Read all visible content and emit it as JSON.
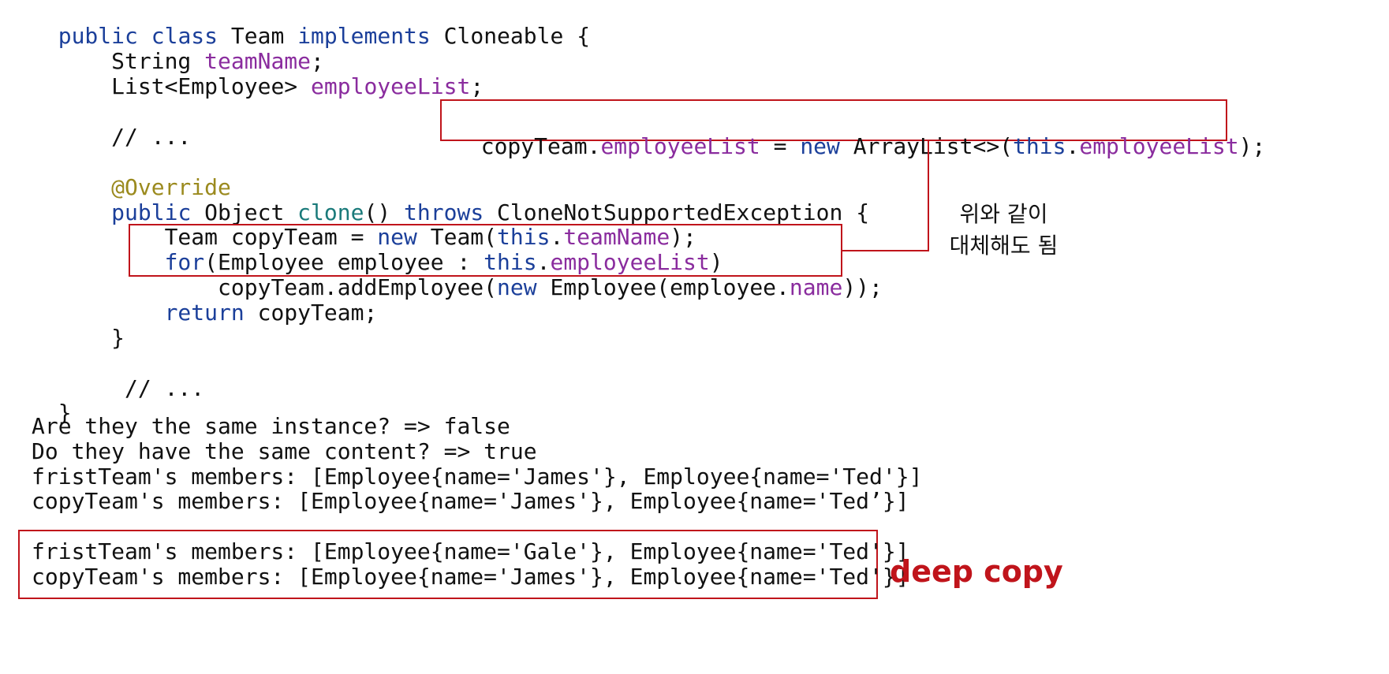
{
  "code": {
    "l1": [
      "public",
      " ",
      "class",
      " Team ",
      "implements",
      " Cloneable {"
    ],
    "l2": [
      "    String ",
      "teamName",
      ";"
    ],
    "l3": [
      "    List<Employee> ",
      "employeeList",
      ";"
    ],
    "l4": "    // ...",
    "l5": "    @Override",
    "l6": [
      "    ",
      "public",
      " Object ",
      "clone",
      "() ",
      "throws",
      " CloneNotSupportedException {"
    ],
    "l7": [
      "        Team copyTeam = ",
      "new",
      " Team(",
      "this",
      ".",
      "teamName",
      ");"
    ],
    "l8": [
      "        ",
      "for",
      "(Employee employee : ",
      "this",
      ".",
      "employeeList",
      ")"
    ],
    "l9": [
      "            copyTeam.addEmployee(",
      "new",
      " Employee(employee.",
      "name",
      "));"
    ],
    "l10": [
      "        ",
      "return",
      " copyTeam;"
    ],
    "l11": "    }",
    "l12": "     // ...",
    "l13": "}"
  },
  "replacement": [
    "copyTeam.",
    "employeeList",
    " = ",
    "new",
    " ArrayList<>(",
    "this",
    ".",
    "employeeList",
    ");"
  ],
  "note": {
    "line1": "위와 같이",
    "line2": "대체해도 됨"
  },
  "output": {
    "o1": "Are they the same instance? => false",
    "o2": "Do they have the same content? => true",
    "o3": "fristTeam's members: [Employee{name='James'}, Employee{name='Ted'}]",
    "o4": "copyTeam's members: [Employee{name='James'}, Employee{name='Ted’}]",
    "o5": "fristTeam's members: [Employee{name='Gale'}, Employee{name='Ted'}]",
    "o6": "copyTeam's members: [Employee{name='James'}, Employee{name='Ted'}]"
  },
  "label": {
    "deep_copy": "deep copy"
  },
  "colors": {
    "keyword": "#1b3f9a",
    "field": "#8a2c9e",
    "annotation": "#9b8a1e",
    "method": "#1a7a7a",
    "highlight": "#c0141b"
  }
}
